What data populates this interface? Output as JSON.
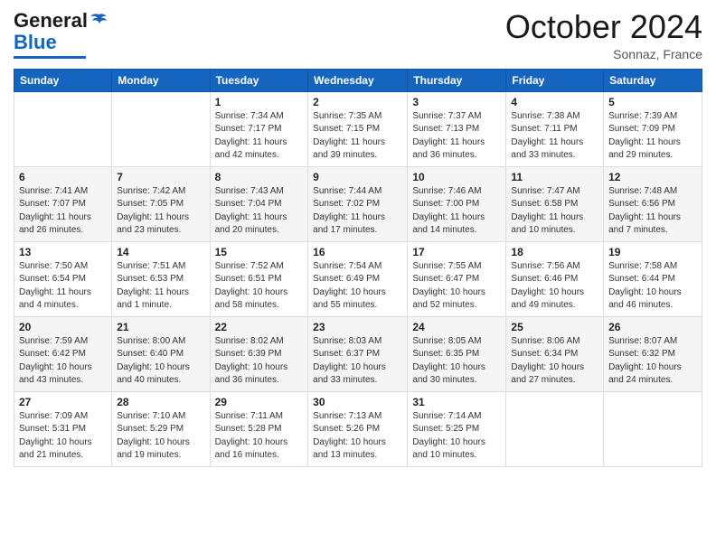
{
  "header": {
    "logo_general": "General",
    "logo_blue": "Blue",
    "month": "October 2024",
    "location": "Sonnaz, France"
  },
  "weekdays": [
    "Sunday",
    "Monday",
    "Tuesday",
    "Wednesday",
    "Thursday",
    "Friday",
    "Saturday"
  ],
  "weeks": [
    [
      {
        "day": "",
        "sunrise": "",
        "sunset": "",
        "daylight": ""
      },
      {
        "day": "",
        "sunrise": "",
        "sunset": "",
        "daylight": ""
      },
      {
        "day": "1",
        "sunrise": "Sunrise: 7:34 AM",
        "sunset": "Sunset: 7:17 PM",
        "daylight": "Daylight: 11 hours and 42 minutes."
      },
      {
        "day": "2",
        "sunrise": "Sunrise: 7:35 AM",
        "sunset": "Sunset: 7:15 PM",
        "daylight": "Daylight: 11 hours and 39 minutes."
      },
      {
        "day": "3",
        "sunrise": "Sunrise: 7:37 AM",
        "sunset": "Sunset: 7:13 PM",
        "daylight": "Daylight: 11 hours and 36 minutes."
      },
      {
        "day": "4",
        "sunrise": "Sunrise: 7:38 AM",
        "sunset": "Sunset: 7:11 PM",
        "daylight": "Daylight: 11 hours and 33 minutes."
      },
      {
        "day": "5",
        "sunrise": "Sunrise: 7:39 AM",
        "sunset": "Sunset: 7:09 PM",
        "daylight": "Daylight: 11 hours and 29 minutes."
      }
    ],
    [
      {
        "day": "6",
        "sunrise": "Sunrise: 7:41 AM",
        "sunset": "Sunset: 7:07 PM",
        "daylight": "Daylight: 11 hours and 26 minutes."
      },
      {
        "day": "7",
        "sunrise": "Sunrise: 7:42 AM",
        "sunset": "Sunset: 7:05 PM",
        "daylight": "Daylight: 11 hours and 23 minutes."
      },
      {
        "day": "8",
        "sunrise": "Sunrise: 7:43 AM",
        "sunset": "Sunset: 7:04 PM",
        "daylight": "Daylight: 11 hours and 20 minutes."
      },
      {
        "day": "9",
        "sunrise": "Sunrise: 7:44 AM",
        "sunset": "Sunset: 7:02 PM",
        "daylight": "Daylight: 11 hours and 17 minutes."
      },
      {
        "day": "10",
        "sunrise": "Sunrise: 7:46 AM",
        "sunset": "Sunset: 7:00 PM",
        "daylight": "Daylight: 11 hours and 14 minutes."
      },
      {
        "day": "11",
        "sunrise": "Sunrise: 7:47 AM",
        "sunset": "Sunset: 6:58 PM",
        "daylight": "Daylight: 11 hours and 10 minutes."
      },
      {
        "day": "12",
        "sunrise": "Sunrise: 7:48 AM",
        "sunset": "Sunset: 6:56 PM",
        "daylight": "Daylight: 11 hours and 7 minutes."
      }
    ],
    [
      {
        "day": "13",
        "sunrise": "Sunrise: 7:50 AM",
        "sunset": "Sunset: 6:54 PM",
        "daylight": "Daylight: 11 hours and 4 minutes."
      },
      {
        "day": "14",
        "sunrise": "Sunrise: 7:51 AM",
        "sunset": "Sunset: 6:53 PM",
        "daylight": "Daylight: 11 hours and 1 minute."
      },
      {
        "day": "15",
        "sunrise": "Sunrise: 7:52 AM",
        "sunset": "Sunset: 6:51 PM",
        "daylight": "Daylight: 10 hours and 58 minutes."
      },
      {
        "day": "16",
        "sunrise": "Sunrise: 7:54 AM",
        "sunset": "Sunset: 6:49 PM",
        "daylight": "Daylight: 10 hours and 55 minutes."
      },
      {
        "day": "17",
        "sunrise": "Sunrise: 7:55 AM",
        "sunset": "Sunset: 6:47 PM",
        "daylight": "Daylight: 10 hours and 52 minutes."
      },
      {
        "day": "18",
        "sunrise": "Sunrise: 7:56 AM",
        "sunset": "Sunset: 6:46 PM",
        "daylight": "Daylight: 10 hours and 49 minutes."
      },
      {
        "day": "19",
        "sunrise": "Sunrise: 7:58 AM",
        "sunset": "Sunset: 6:44 PM",
        "daylight": "Daylight: 10 hours and 46 minutes."
      }
    ],
    [
      {
        "day": "20",
        "sunrise": "Sunrise: 7:59 AM",
        "sunset": "Sunset: 6:42 PM",
        "daylight": "Daylight: 10 hours and 43 minutes."
      },
      {
        "day": "21",
        "sunrise": "Sunrise: 8:00 AM",
        "sunset": "Sunset: 6:40 PM",
        "daylight": "Daylight: 10 hours and 40 minutes."
      },
      {
        "day": "22",
        "sunrise": "Sunrise: 8:02 AM",
        "sunset": "Sunset: 6:39 PM",
        "daylight": "Daylight: 10 hours and 36 minutes."
      },
      {
        "day": "23",
        "sunrise": "Sunrise: 8:03 AM",
        "sunset": "Sunset: 6:37 PM",
        "daylight": "Daylight: 10 hours and 33 minutes."
      },
      {
        "day": "24",
        "sunrise": "Sunrise: 8:05 AM",
        "sunset": "Sunset: 6:35 PM",
        "daylight": "Daylight: 10 hours and 30 minutes."
      },
      {
        "day": "25",
        "sunrise": "Sunrise: 8:06 AM",
        "sunset": "Sunset: 6:34 PM",
        "daylight": "Daylight: 10 hours and 27 minutes."
      },
      {
        "day": "26",
        "sunrise": "Sunrise: 8:07 AM",
        "sunset": "Sunset: 6:32 PM",
        "daylight": "Daylight: 10 hours and 24 minutes."
      }
    ],
    [
      {
        "day": "27",
        "sunrise": "Sunrise: 7:09 AM",
        "sunset": "Sunset: 5:31 PM",
        "daylight": "Daylight: 10 hours and 21 minutes."
      },
      {
        "day": "28",
        "sunrise": "Sunrise: 7:10 AM",
        "sunset": "Sunset: 5:29 PM",
        "daylight": "Daylight: 10 hours and 19 minutes."
      },
      {
        "day": "29",
        "sunrise": "Sunrise: 7:11 AM",
        "sunset": "Sunset: 5:28 PM",
        "daylight": "Daylight: 10 hours and 16 minutes."
      },
      {
        "day": "30",
        "sunrise": "Sunrise: 7:13 AM",
        "sunset": "Sunset: 5:26 PM",
        "daylight": "Daylight: 10 hours and 13 minutes."
      },
      {
        "day": "31",
        "sunrise": "Sunrise: 7:14 AM",
        "sunset": "Sunset: 5:25 PM",
        "daylight": "Daylight: 10 hours and 10 minutes."
      },
      {
        "day": "",
        "sunrise": "",
        "sunset": "",
        "daylight": ""
      },
      {
        "day": "",
        "sunrise": "",
        "sunset": "",
        "daylight": ""
      }
    ]
  ]
}
